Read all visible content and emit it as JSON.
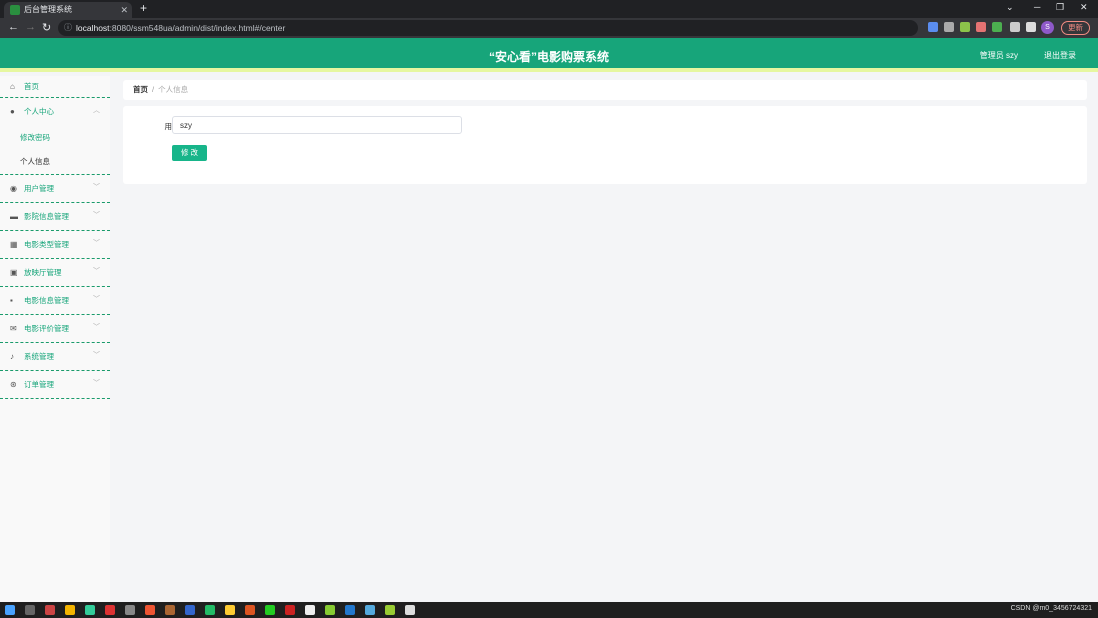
{
  "browser": {
    "tab_title": "后台管理系统",
    "tab_close": "✕",
    "new_tab": "+",
    "url_host": "localhost",
    "url_rest": ":8080/ssm548ua/admin/dist/index.html#/center",
    "update_label": "更新",
    "profile_initial": "S",
    "min_glyph": "─",
    "max_glyph": "❐",
    "close_glyph": "✕",
    "down_glyph": "⌄"
  },
  "header": {
    "title": "“安心看”电影购票系统",
    "admin_label": "管理员 szy",
    "logout_label": "退出登录"
  },
  "sidebar": {
    "home": {
      "label": "首页",
      "icon": "home-icon"
    },
    "personal": {
      "label": "个人中心",
      "icon": "user-icon",
      "children": [
        "修改密码",
        "个人信息"
      ]
    },
    "items": [
      {
        "label": "用户管理",
        "icon": "location-icon"
      },
      {
        "label": "影院信息管理",
        "icon": "briefcase-icon"
      },
      {
        "label": "电影类型管理",
        "icon": "grid-icon"
      },
      {
        "label": "放映厅管理",
        "icon": "clipboard-icon"
      },
      {
        "label": "电影信息管理",
        "icon": "apps-icon"
      },
      {
        "label": "电影评价管理",
        "icon": "mail-icon"
      },
      {
        "label": "系统管理",
        "icon": "mic-icon"
      },
      {
        "label": "订单管理",
        "icon": "help-icon"
      }
    ]
  },
  "breadcrumb": {
    "home": "首页",
    "separator": "/",
    "current": "个人信息"
  },
  "form": {
    "username_label": "用户名",
    "username_value": "szy",
    "submit_label": "修 改"
  },
  "taskbar": {
    "tray_text": "CSDN @m0_3456724321"
  },
  "colors": {
    "accent": "#17a57a",
    "header_underline": "#e6f7a0",
    "button": "#17b58a"
  }
}
